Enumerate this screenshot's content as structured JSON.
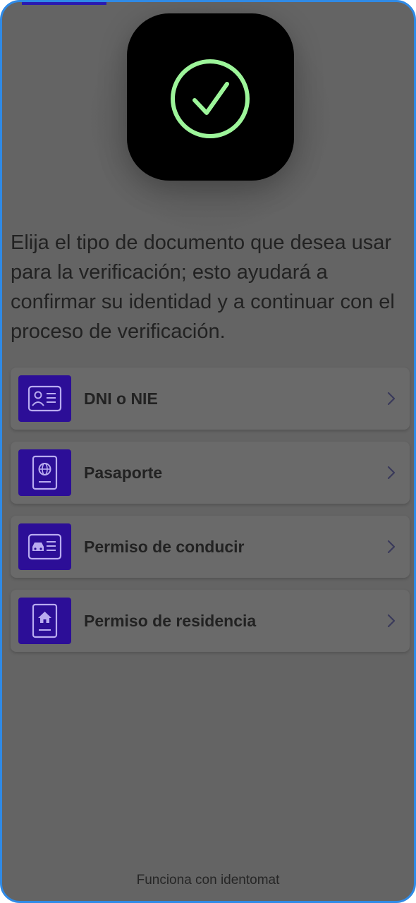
{
  "header": {
    "logo_icon": "check-circle-icon",
    "accent_color": "#9df59a"
  },
  "intro_text": "Elija el tipo de documento que desea usar para la verificación; esto ayudará a confirmar su identidad y a continuar con el proceso de verificación.",
  "document_options": [
    {
      "label": "DNI o NIE",
      "icon": "id-card-icon"
    },
    {
      "label": "Pasaporte",
      "icon": "passport-icon"
    },
    {
      "label": "Permiso de conducir",
      "icon": "driving-license-icon"
    },
    {
      "label": "Permiso de residencia",
      "icon": "residence-permit-icon"
    }
  ],
  "option_icon_bg": "#2c0e97",
  "footer": {
    "text": "Funciona con identomat"
  }
}
